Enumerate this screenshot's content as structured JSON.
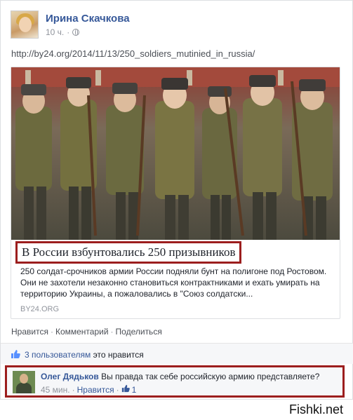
{
  "post": {
    "author": "Ирина Скачкова",
    "time": "10 ч.",
    "separator": "·",
    "text": "http://by24.org/2014/11/13/250_soldiers_mutinied_in_russia/"
  },
  "share": {
    "headline": "В России взбунтовались 250 призывников",
    "description": "250 солдат-срочников армии России подняли бунт на полигоне под Ростовом. Они не захотели незаконно становиться контрактниками и ехать умирать на территорию Украины, а пожаловались в \"Союз солдатски...",
    "domain": "BY24.ORG"
  },
  "actions": {
    "like": "Нравится",
    "comment": "Комментарий",
    "share": "Поделиться",
    "sep": "·"
  },
  "likes": {
    "users_link": "3 пользователям",
    "suffix": "это нравится"
  },
  "comment": {
    "author": "Олег Дядьков",
    "text": "Вы правда так себе российскую армию представляете?",
    "time": "45 мин.",
    "sep": "·",
    "like": "Нравится",
    "like_count": "1"
  },
  "watermark": "Fishki.net",
  "colors": {
    "link": "#365899",
    "highlight_border": "#9c1e1e",
    "muted": "#90949c"
  }
}
